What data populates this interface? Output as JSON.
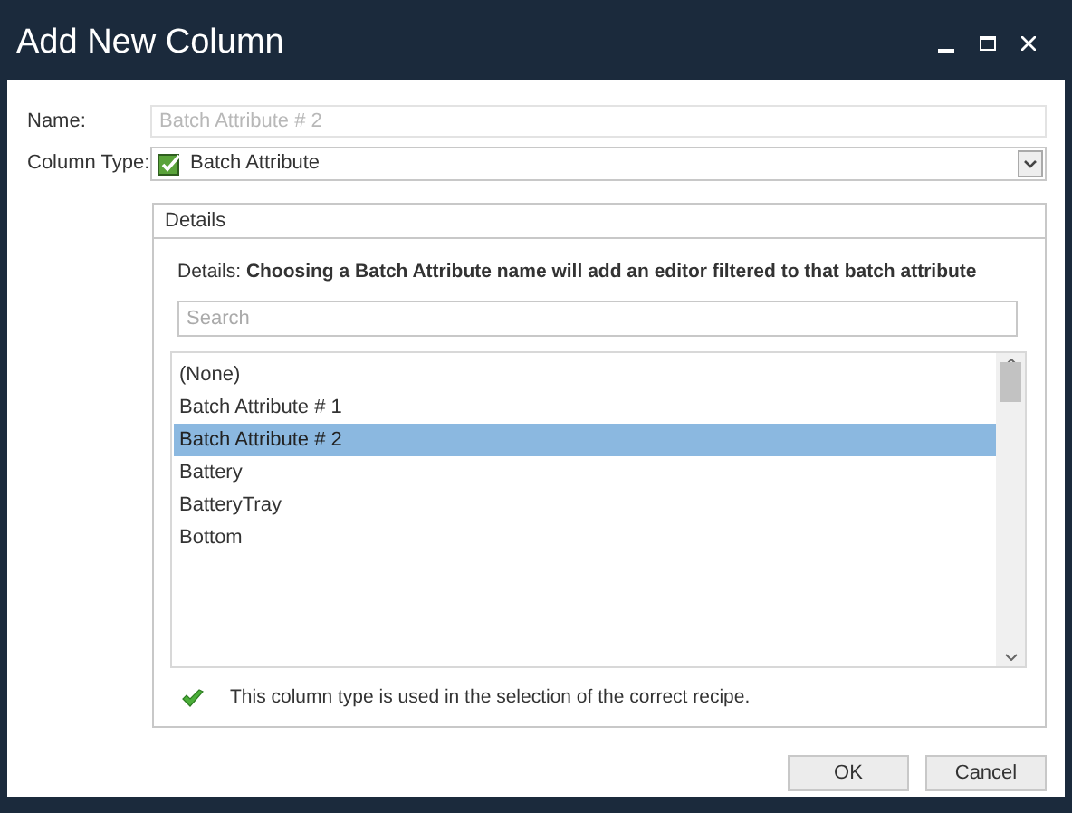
{
  "window": {
    "title": "Add New Column"
  },
  "name_field": {
    "label": "Name:",
    "value": "Batch Attribute # 2",
    "disabled": true
  },
  "column_type": {
    "label": "Column Type:",
    "value": "Batch Attribute"
  },
  "details": {
    "title": "Details",
    "description": "Details: **Choosing a Batch Attribute name will add an editor filtered to that batch attribute**",
    "search": {
      "placeholder": "Search"
    },
    "items": [
      {
        "label": "(None)",
        "selected": false
      },
      {
        "label": "Batch Attribute # 1",
        "selected": false
      },
      {
        "label": "Batch Attribute # 2",
        "selected": true
      },
      {
        "label": "Battery",
        "selected": false
      },
      {
        "label": "BatteryTray",
        "selected": false
      },
      {
        "label": "Bottom",
        "selected": false
      }
    ],
    "note": "This column type is used in the selection of the correct recipe."
  },
  "buttons": [
    "OK",
    "Cancel"
  ]
}
